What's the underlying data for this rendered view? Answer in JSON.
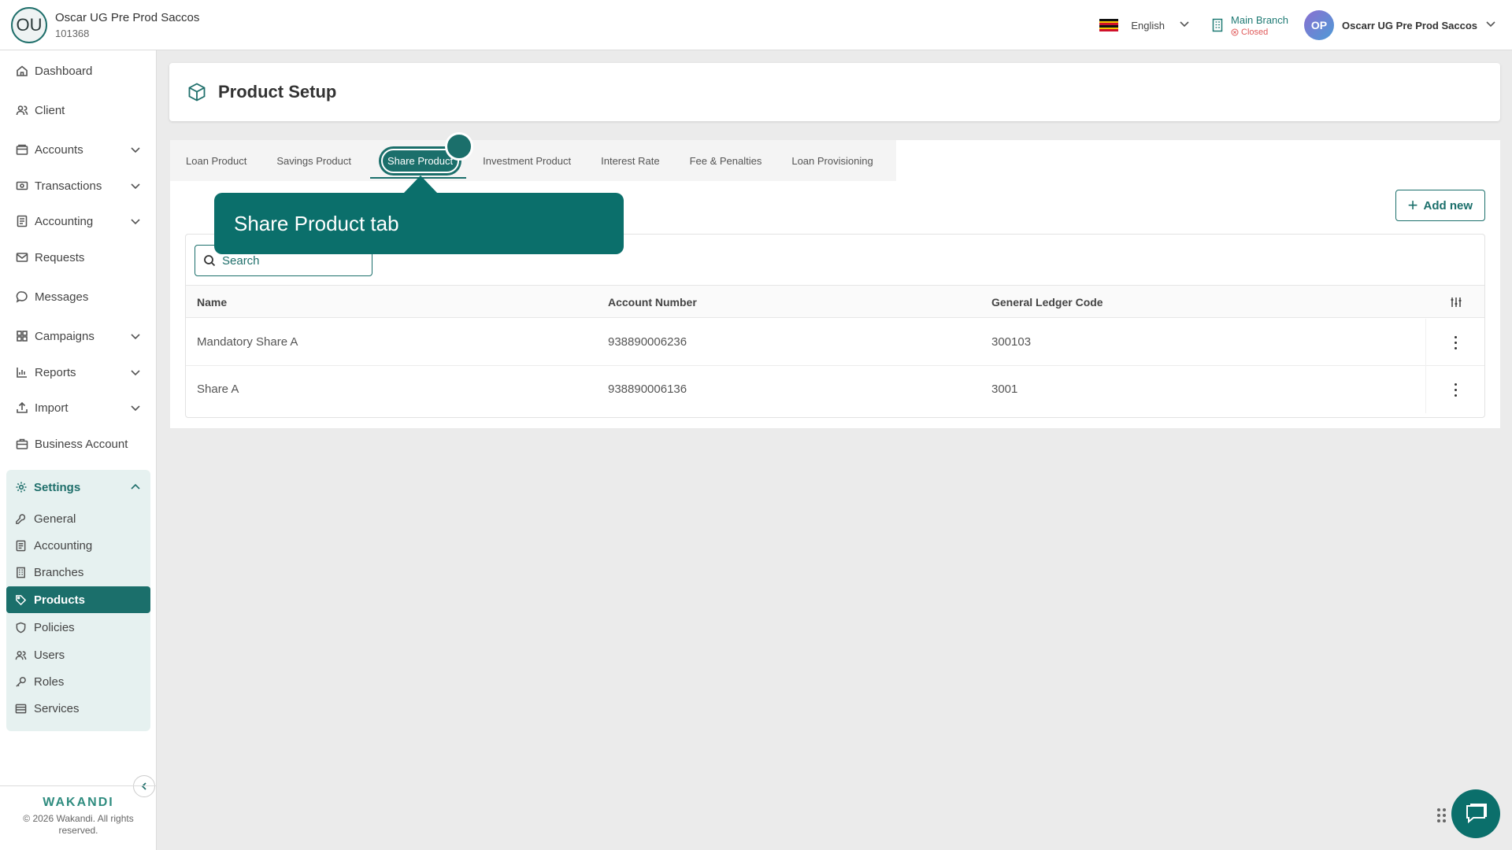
{
  "header": {
    "org_initials": "OU",
    "org_name": "Oscar UG Pre Prod Saccos",
    "org_id": "101368",
    "language": "English",
    "branch_name": "Main Branch",
    "branch_status": "Closed",
    "user_initials": "OP",
    "user_name": "Oscarr UG Pre Prod Saccos"
  },
  "sidebar": {
    "items": [
      {
        "label": "Dashboard",
        "icon": "home-icon"
      },
      {
        "label": "Client",
        "icon": "users-icon"
      },
      {
        "label": "Accounts",
        "icon": "wallet-icon"
      },
      {
        "label": "Transactions",
        "icon": "cash-icon"
      },
      {
        "label": "Accounting",
        "icon": "ledger-icon"
      },
      {
        "label": "Requests",
        "icon": "mail-icon"
      },
      {
        "label": "Messages",
        "icon": "chat-icon"
      },
      {
        "label": "Campaigns",
        "icon": "grid-icon"
      },
      {
        "label": "Reports",
        "icon": "bar-chart-icon"
      },
      {
        "label": "Import",
        "icon": "upload-icon"
      },
      {
        "label": "Business Account",
        "icon": "briefcase-icon"
      }
    ],
    "settings": {
      "label": "Settings",
      "items": [
        {
          "label": "General"
        },
        {
          "label": "Accounting"
        },
        {
          "label": "Branches"
        },
        {
          "label": "Products"
        },
        {
          "label": "Policies"
        },
        {
          "label": "Users"
        },
        {
          "label": "Roles"
        },
        {
          "label": "Services"
        }
      ]
    },
    "footer": {
      "brand": "WAKANDI",
      "copyright": "© 2026 Wakandi. All rights reserved."
    }
  },
  "main": {
    "title": "Product Setup",
    "tabs": [
      {
        "label": "Loan Product"
      },
      {
        "label": "Savings Product"
      },
      {
        "label": "Share Product"
      },
      {
        "label": "Investment Product"
      },
      {
        "label": "Interest Rate"
      },
      {
        "label": "Fee & Penalties"
      },
      {
        "label": "Loan Provisioning"
      }
    ],
    "add_button": "Add new",
    "search_placeholder": "Search",
    "table": {
      "columns": [
        "Name",
        "Account Number",
        "General Ledger Code"
      ],
      "rows": [
        {
          "name": "Mandatory Share A",
          "account_number": "938890006236",
          "gl_code": "300103"
        },
        {
          "name": "Share A",
          "account_number": "938890006136",
          "gl_code": "3001"
        }
      ]
    }
  },
  "tooltip": {
    "text": "Share Product tab"
  },
  "colors": {
    "accent": "#1b6f6b",
    "closed_status": "#e05a5a"
  }
}
